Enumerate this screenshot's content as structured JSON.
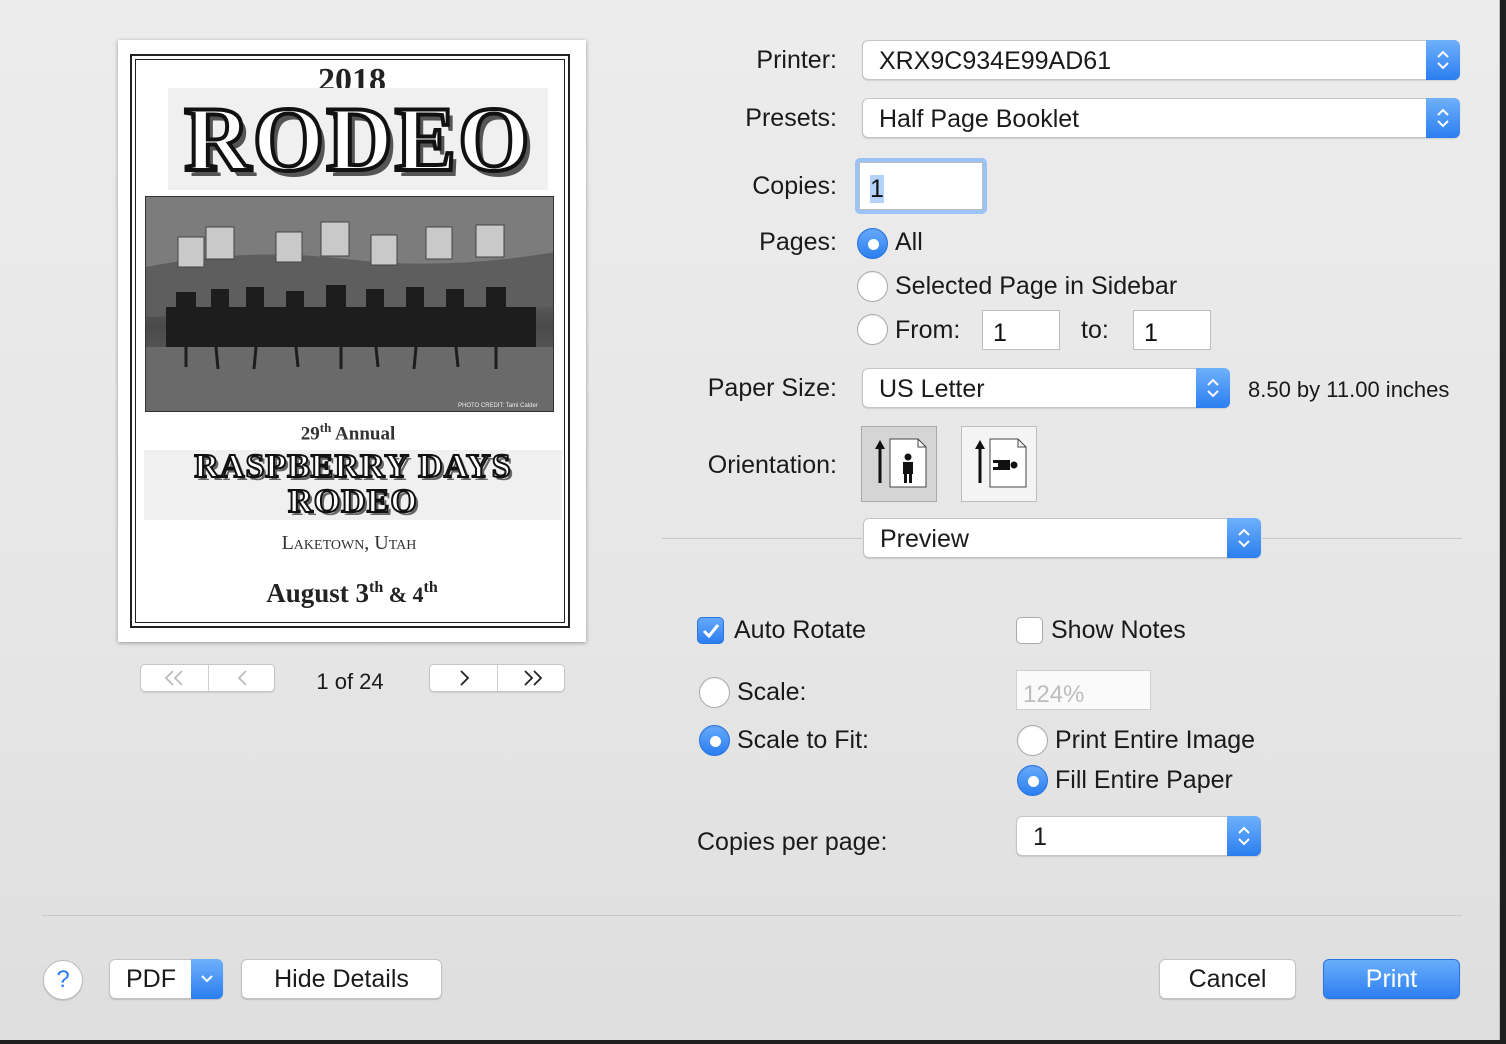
{
  "preview": {
    "year": "2018",
    "rodeo_title": "RODEO",
    "photo_credit": "PHOTO CREDIT: Tami Calder",
    "annual_num": "29",
    "annual_sup": "th",
    "annual_word": "Annual",
    "event_line1": "RASPBERRY DAYS",
    "event_line2": "RODEO",
    "location": "Laketown, Utah",
    "date_main": "August 3",
    "date_sup1": "th",
    "date_amp": " & 4",
    "date_sup2": "th"
  },
  "pager": {
    "first": "<<",
    "prev": "<",
    "page_indicator": "1 of 24",
    "next": ">",
    "last": ">>"
  },
  "printer": {
    "label": "Printer:",
    "value": "XRX9C934E99AD61"
  },
  "presets": {
    "label": "Presets:",
    "value": "Half Page Booklet"
  },
  "copies": {
    "label": "Copies:",
    "value": "1"
  },
  "pages": {
    "label": "Pages:",
    "all": "All",
    "selected": "Selected Page in Sidebar",
    "from_label": "From:",
    "from_value": "1",
    "to_label": "to:",
    "to_value": "1"
  },
  "paper_size": {
    "label": "Paper Size:",
    "value": "US Letter",
    "dimensions": "8.50 by 11.00 inches"
  },
  "orientation": {
    "label": "Orientation:",
    "selected": "portrait"
  },
  "section_popup": {
    "value": "Preview"
  },
  "options": {
    "auto_rotate": "Auto Rotate",
    "show_notes": "Show Notes",
    "scale_label": "Scale:",
    "scale_value": "124%",
    "scale_to_fit": "Scale to Fit:",
    "print_entire_image": "Print Entire Image",
    "fill_entire_paper": "Fill Entire Paper",
    "copies_per_page_label": "Copies per page:",
    "copies_per_page_value": "1"
  },
  "footer": {
    "help": "?",
    "pdf": "PDF",
    "hide_details": "Hide Details",
    "cancel": "Cancel",
    "print": "Print"
  },
  "colors": {
    "accent": "#2a7ef0",
    "dialog_bg": "#e8e8e8"
  }
}
